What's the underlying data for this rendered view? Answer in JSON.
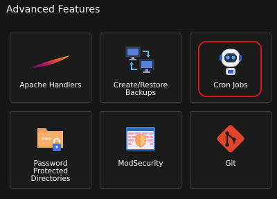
{
  "section": {
    "title": "Advanced Features"
  },
  "tiles": [
    {
      "label": "Apache Handlers",
      "icon": "apache-feather-icon"
    },
    {
      "label": "Create/Restore\nBackups",
      "icon": "backup-monitors-icon"
    },
    {
      "label": "Cron Jobs",
      "icon": "robot-icon"
    },
    {
      "label": "Password\nProtected\nDirectories",
      "icon": "locked-folder-icon"
    },
    {
      "label": "ModSecurity",
      "icon": "shield-firewall-icon"
    },
    {
      "label": "Git",
      "icon": "git-logo-icon"
    }
  ],
  "colors": {
    "background": "#161616",
    "tile_border": "#444444",
    "highlight": "#d9131a",
    "git_red": "#e0452c",
    "folder_orange": "#f5a35a"
  }
}
